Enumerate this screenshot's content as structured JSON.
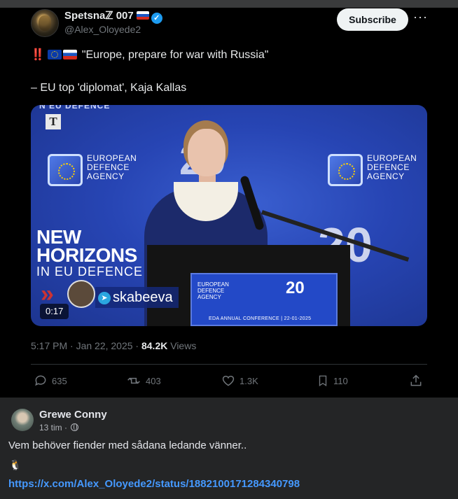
{
  "tweet": {
    "display_name": "Spetsnaℤ 007",
    "handle": "@Alex_Oloyede2",
    "subscribe_label": "Subscribe",
    "more_label": "···",
    "alert_prefix": "‼️",
    "quote": "\"Europe, prepare for war with Russia\"",
    "attribution": "– EU top 'diplomat', Kaja Kallas",
    "timestamp": "5:17 PM · Jan 22, 2025 · ",
    "views_count": "84.2K",
    "views_label": " Views",
    "stats": {
      "replies": "635",
      "reposts": "403",
      "likes": "1.3K",
      "bookmarks": "110"
    }
  },
  "video": {
    "top_banner": "N EU DEFENCE",
    "t_logo": "T",
    "eda_text": "EUROPEAN\nDEFENCE\nAGENCY",
    "horizons_line1": "NEW",
    "horizons_line2": "HORIZONS",
    "horizons_line3": "IN EU DEFENCE",
    "big_20": "20",
    "podium_logo": "EUROPEAN DEFENCE AGENCY",
    "podium_20": "20",
    "podium_conf": "EDA ANNUAL CONFERENCE | 22-01-2025",
    "channel": "skabeeva",
    "duration": "0:17"
  },
  "comment": {
    "author": "Grewe Conny",
    "time": "13 tim · ",
    "text": "Vem behöver fiender med sådana ledande vänner..",
    "emoji": "🐧",
    "link": "https://x.com/Alex_Oloyede2/status/1882100171284340798"
  },
  "colors": {
    "tweet_bg": "#000000",
    "comment_bg": "#242526",
    "link": "#4599ff",
    "verified": "#1d9bf0",
    "video_blue": "#2745b4"
  }
}
